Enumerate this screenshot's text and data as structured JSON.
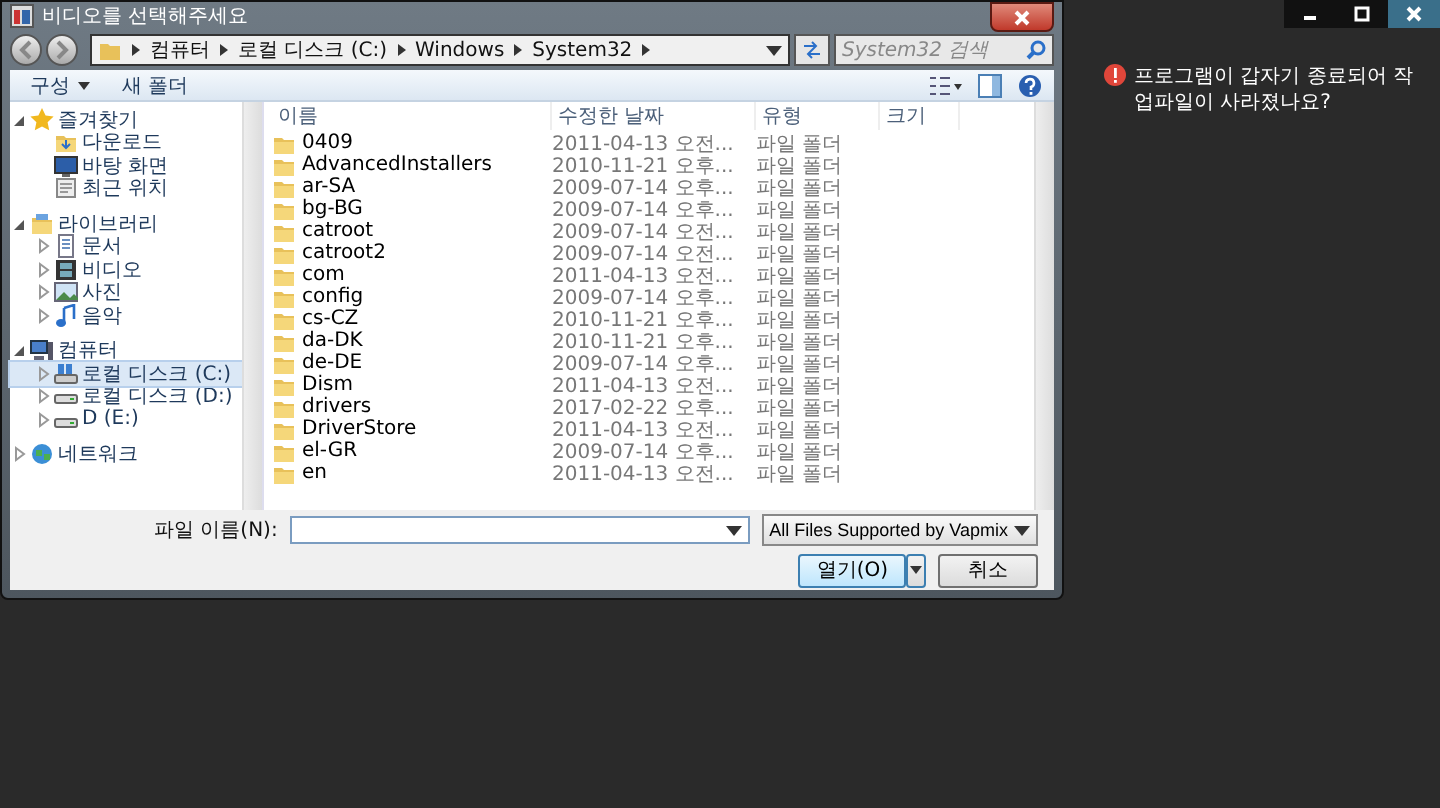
{
  "dialog": {
    "title": "비디오를 선택해주세요",
    "breadcrumb": [
      "컴퓨터",
      "로컬 디스크 (C:)",
      "Windows",
      "System32"
    ],
    "search": {
      "placeholder": "System32 검색"
    },
    "toolbar": [
      {
        "label": "구성",
        "dropdown": true
      },
      {
        "label": "새 폴더",
        "dropdown": false
      }
    ],
    "nav": [
      {
        "label": "즐겨찾기",
        "kind": "star",
        "expanded": true,
        "selected": false,
        "children": [
          {
            "label": "다운로드",
            "kind": "download",
            "selected": false
          },
          {
            "label": "바탕 화면",
            "kind": "desktop",
            "selected": false
          },
          {
            "label": "최근 위치",
            "kind": "recent",
            "selected": false
          }
        ]
      },
      {
        "label": "라이브러리",
        "kind": "library",
        "expanded": true,
        "selected": false,
        "children": [
          {
            "label": "문서",
            "kind": "document",
            "expanded": false,
            "selected": false
          },
          {
            "label": "비디오",
            "kind": "film",
            "expanded": false,
            "selected": false
          },
          {
            "label": "사진",
            "kind": "picture",
            "expanded": false,
            "selected": false
          },
          {
            "label": "음악",
            "kind": "music",
            "expanded": false,
            "selected": false
          }
        ]
      },
      {
        "label": "컴퓨터",
        "kind": "computer",
        "expanded": true,
        "selected": false,
        "children": [
          {
            "label": "로컬 디스크 (C:)",
            "kind": "system-drive",
            "expanded": false,
            "selected": true
          },
          {
            "label": "로컬 디스크 (D:)",
            "kind": "drive",
            "expanded": false,
            "selected": false
          },
          {
            "label": "D (E:)",
            "kind": "drive",
            "expanded": false,
            "selected": false
          }
        ]
      },
      {
        "label": "네트워크",
        "kind": "network",
        "expanded": false,
        "selected": false
      }
    ],
    "columns": [
      "이름",
      "수정한 날짜",
      "유형",
      "크기"
    ],
    "rows": [
      {
        "name": "0409",
        "date": "2011-04-13 오전...",
        "type": "파일 폴더"
      },
      {
        "name": "AdvancedInstallers",
        "date": "2010-11-21 오후...",
        "type": "파일 폴더"
      },
      {
        "name": "ar-SA",
        "date": "2009-07-14 오후...",
        "type": "파일 폴더"
      },
      {
        "name": "bg-BG",
        "date": "2009-07-14 오후...",
        "type": "파일 폴더"
      },
      {
        "name": "catroot",
        "date": "2009-07-14 오전...",
        "type": "파일 폴더"
      },
      {
        "name": "catroot2",
        "date": "2009-07-14 오전...",
        "type": "파일 폴더"
      },
      {
        "name": "com",
        "date": "2011-04-13 오전...",
        "type": "파일 폴더"
      },
      {
        "name": "config",
        "date": "2009-07-14 오후...",
        "type": "파일 폴더"
      },
      {
        "name": "cs-CZ",
        "date": "2010-11-21 오후...",
        "type": "파일 폴더"
      },
      {
        "name": "da-DK",
        "date": "2010-11-21 오후...",
        "type": "파일 폴더"
      },
      {
        "name": "de-DE",
        "date": "2009-07-14 오후...",
        "type": "파일 폴더"
      },
      {
        "name": "Dism",
        "date": "2011-04-13 오전...",
        "type": "파일 폴더"
      },
      {
        "name": "drivers",
        "date": "2017-02-22 오후...",
        "type": "파일 폴더"
      },
      {
        "name": "DriverStore",
        "date": "2011-04-13 오전...",
        "type": "파일 폴더"
      },
      {
        "name": "el-GR",
        "date": "2009-07-14 오후...",
        "type": "파일 폴더"
      },
      {
        "name": "en",
        "date": "2011-04-13 오전...",
        "type": "파일 폴더"
      }
    ],
    "filename_label": "파일 이름(N):",
    "filter": "All Files Supported by Vapmix",
    "buttons": [
      {
        "label": "열기(O)",
        "kind": "split"
      },
      {
        "label": "취소",
        "kind": "plain"
      }
    ]
  },
  "notice": "프로그램이 갑자기 종료되어 작업파일이 사라졌나요?"
}
